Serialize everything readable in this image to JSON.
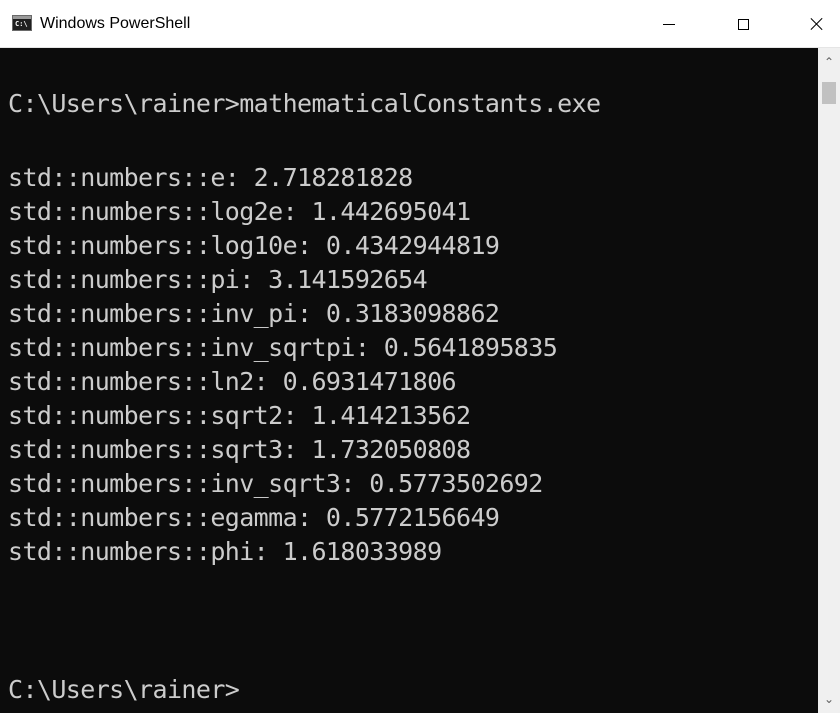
{
  "window": {
    "title": "Windows PowerShell",
    "app_icon_text": "C:\\",
    "controls": {
      "minimize_icon": "minimize-icon",
      "maximize_icon": "maximize-icon",
      "close_icon": "close-icon"
    }
  },
  "console": {
    "command_line": "C:\\Users\\rainer>mathematicalConstants.exe",
    "output": [
      "std::numbers::e: 2.718281828",
      "std::numbers::log2e: 1.442695041",
      "std::numbers::log10e: 0.4342944819",
      "std::numbers::pi: 3.141592654",
      "std::numbers::inv_pi: 0.3183098862",
      "std::numbers::inv_sqrtpi: 0.5641895835",
      "std::numbers::ln2: 0.6931471806",
      "std::numbers::sqrt2: 1.414213562",
      "std::numbers::sqrt3: 1.732050808",
      "std::numbers::inv_sqrt3: 0.5773502692",
      "std::numbers::egamma: 0.5772156649",
      "std::numbers::phi: 1.618033989"
    ],
    "prompt": "C:\\Users\\rainer>"
  },
  "scrollbar": {
    "up_icon": "chevron-up-icon",
    "down_icon": "chevron-down-icon"
  },
  "colors": {
    "console_bg": "#0c0c0c",
    "console_text": "#cccccc",
    "titlebar_bg": "#ffffff"
  }
}
